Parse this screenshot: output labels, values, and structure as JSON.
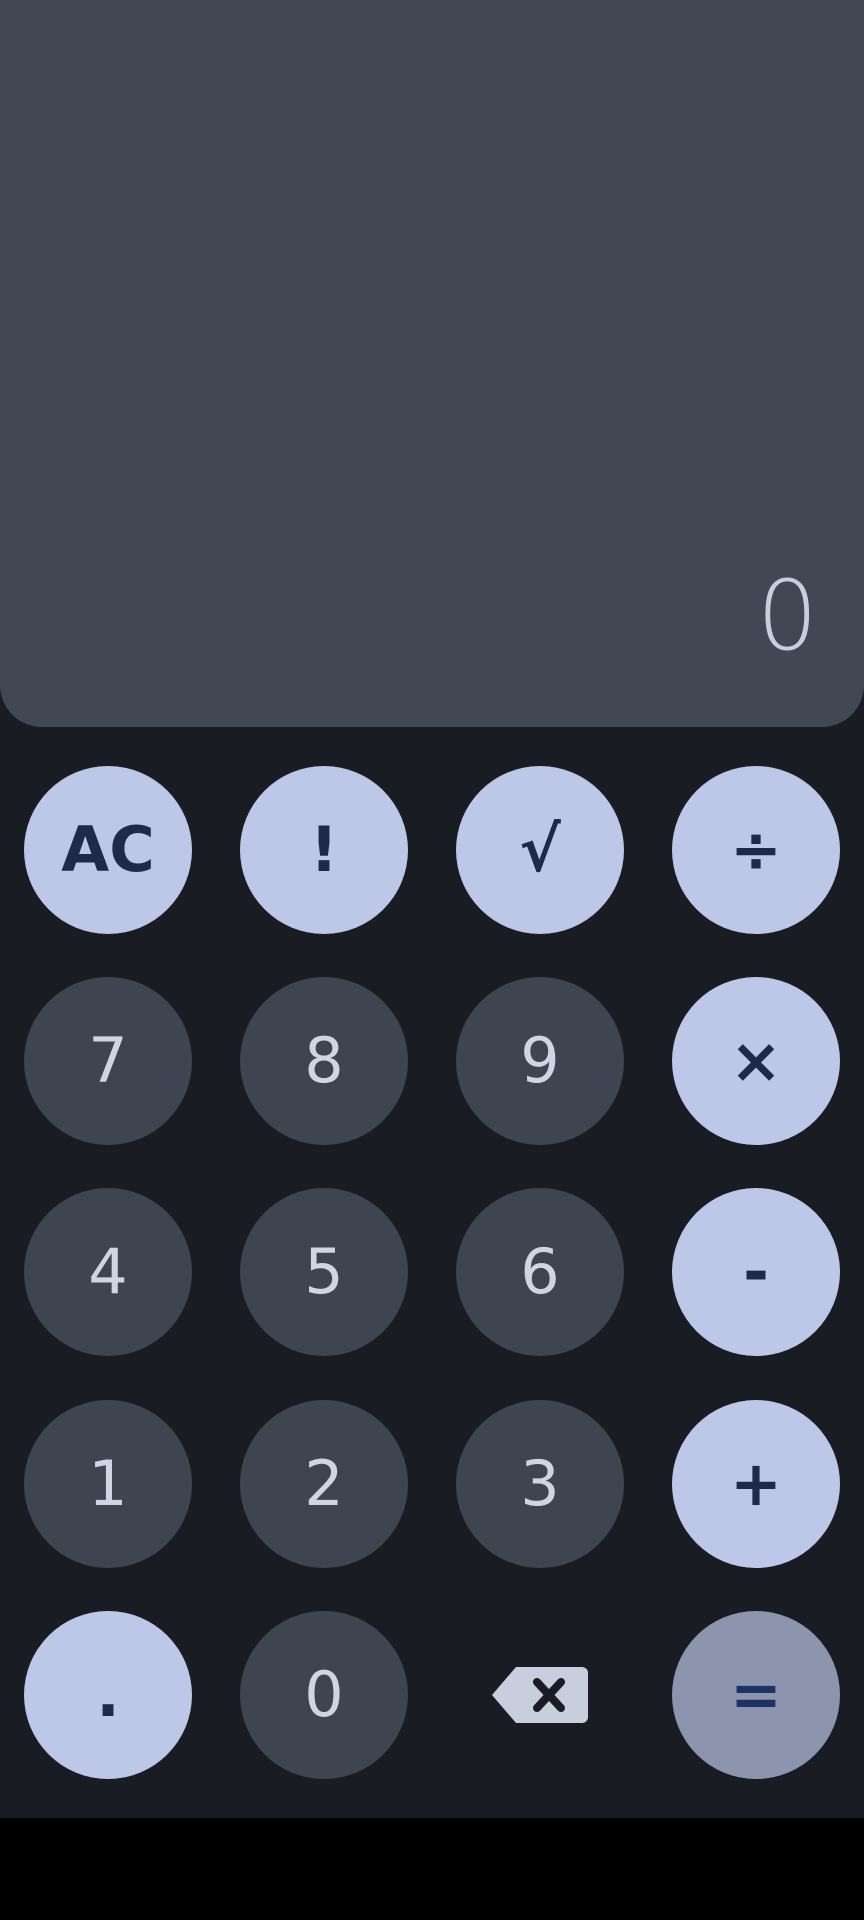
{
  "display": {
    "result": "0"
  },
  "keys": {
    "ac": "AC",
    "factorial": "!",
    "sqrt": "√",
    "divide": "÷",
    "seven": "7",
    "eight": "8",
    "nine": "9",
    "multiply": "×",
    "four": "4",
    "five": "5",
    "six": "6",
    "minus": "-",
    "one": "1",
    "two": "2",
    "three": "3",
    "plus": "+",
    "decimal": ".",
    "zero": "0",
    "backspace_icon": "backspace-icon",
    "equals": "="
  },
  "colors": {
    "display_bg": "#414753",
    "app_bg": "#191c22",
    "function_key": "#bdc7e8",
    "number_key": "#3f4550",
    "equals_key": "#8c95ad"
  }
}
